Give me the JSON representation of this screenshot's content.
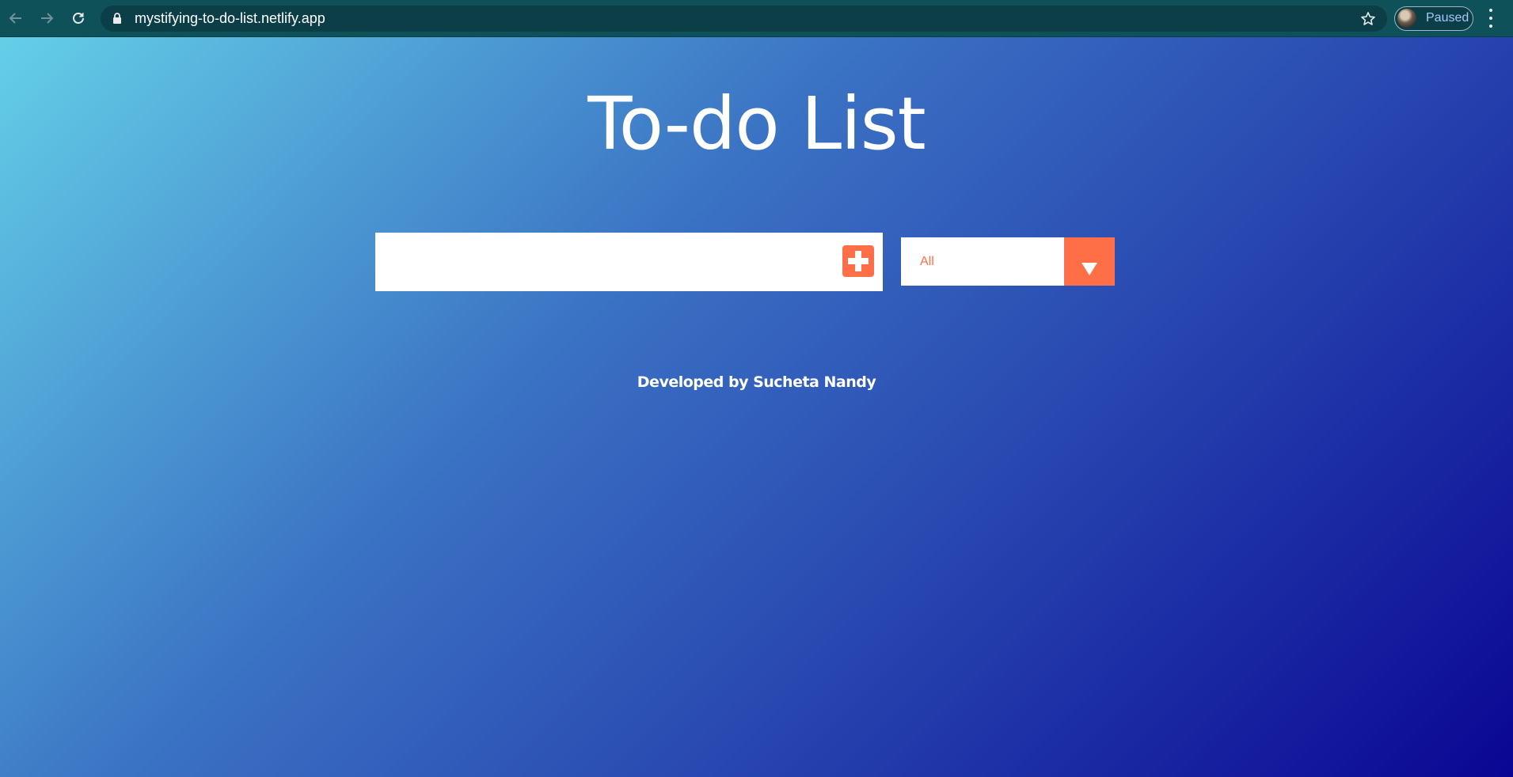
{
  "browser": {
    "url": "mystifying-to-do-list.netlify.app",
    "profile_status": "Paused",
    "icons": {
      "back": "arrow-left-icon",
      "forward": "arrow-right-icon",
      "reload": "reload-icon",
      "lock": "lock-icon",
      "bookmark": "star-icon",
      "menu": "kebab-menu-icon"
    }
  },
  "page": {
    "title": "To-do List",
    "todo_input": {
      "value": "",
      "placeholder": ""
    },
    "add_button_icon": "plus-square-icon",
    "filter": {
      "selected": "All"
    },
    "footer": "Developed by Sucheta Nandy",
    "colors": {
      "accent": "#ff6f47",
      "gradient_start": "#64cfe7",
      "gradient_end": "#0a0693"
    }
  }
}
